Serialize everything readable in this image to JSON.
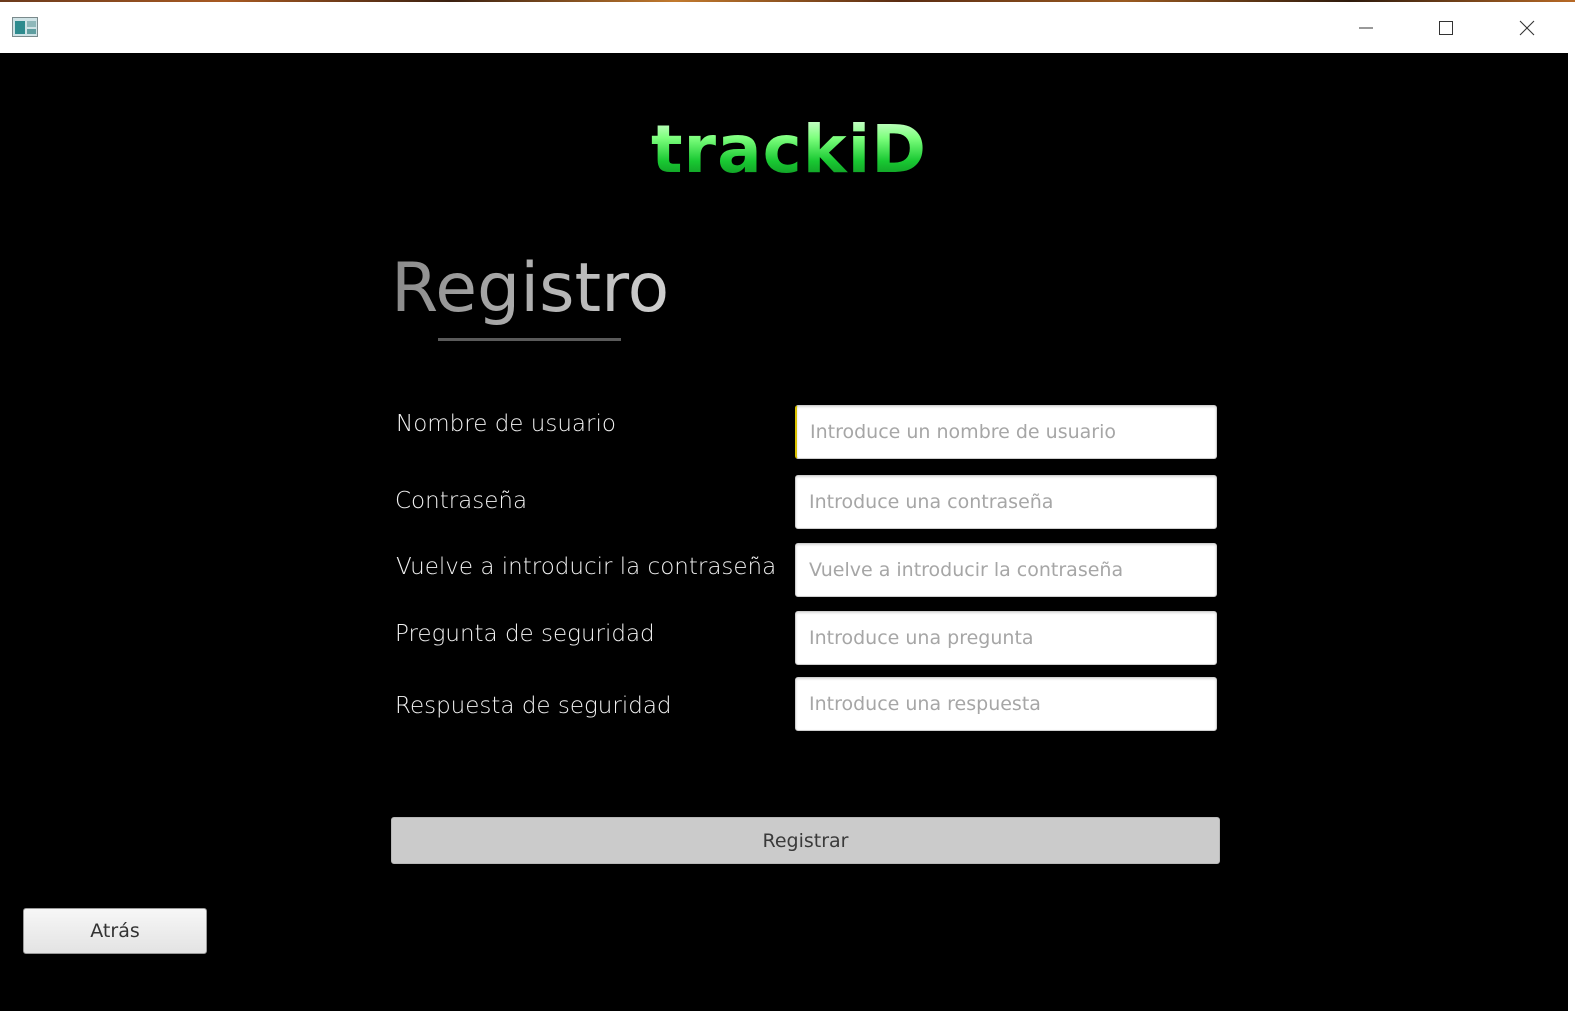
{
  "window": {
    "title": "",
    "controls": {
      "minimize_icon": "minimize-icon",
      "maximize_icon": "maximize-icon",
      "close_icon": "close-icon"
    }
  },
  "brand": {
    "logo_text": "trackiD",
    "logo_color": "#19c832"
  },
  "form": {
    "heading": "Registro",
    "fields": [
      {
        "label": "Nombre de usuario",
        "placeholder": "Introduce un nombre de usuario",
        "value": ""
      },
      {
        "label": "Contraseña",
        "placeholder": "Introduce una contraseña",
        "value": ""
      },
      {
        "label": "Vuelve a introducir la contraseña",
        "placeholder": "Vuelve a introducir la contraseña",
        "value": ""
      },
      {
        "label": "Pregunta de seguridad",
        "placeholder": "Introduce una pregunta",
        "value": ""
      },
      {
        "label": "Respuesta de seguridad",
        "placeholder": "Introduce una respuesta",
        "value": ""
      }
    ],
    "submit_label": "Registrar"
  },
  "navigation": {
    "back_label": "Atrás"
  }
}
